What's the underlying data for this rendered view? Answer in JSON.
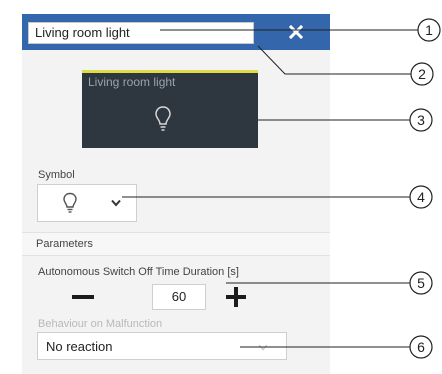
{
  "header": {
    "name_value": "Living room light",
    "close_icon": "close-icon"
  },
  "tile": {
    "label": "Living room light",
    "icon": "lightbulb-icon",
    "accent_color": "#e0dc46"
  },
  "symbol": {
    "label": "Symbol",
    "selected_icon": "lightbulb-icon"
  },
  "parameters": {
    "section_title": "Parameters",
    "auto_off_label": "Autonomous Switch Off Time Duration [s]",
    "auto_off_value": "60",
    "malfunction_label": "Behaviour on Malfunction",
    "malfunction_value": "No reaction"
  },
  "callouts": [
    "1",
    "2",
    "3",
    "4",
    "5",
    "6"
  ],
  "colors": {
    "header": "#3366aa",
    "tile": "#2e3640",
    "panel": "#f3f3f3"
  }
}
